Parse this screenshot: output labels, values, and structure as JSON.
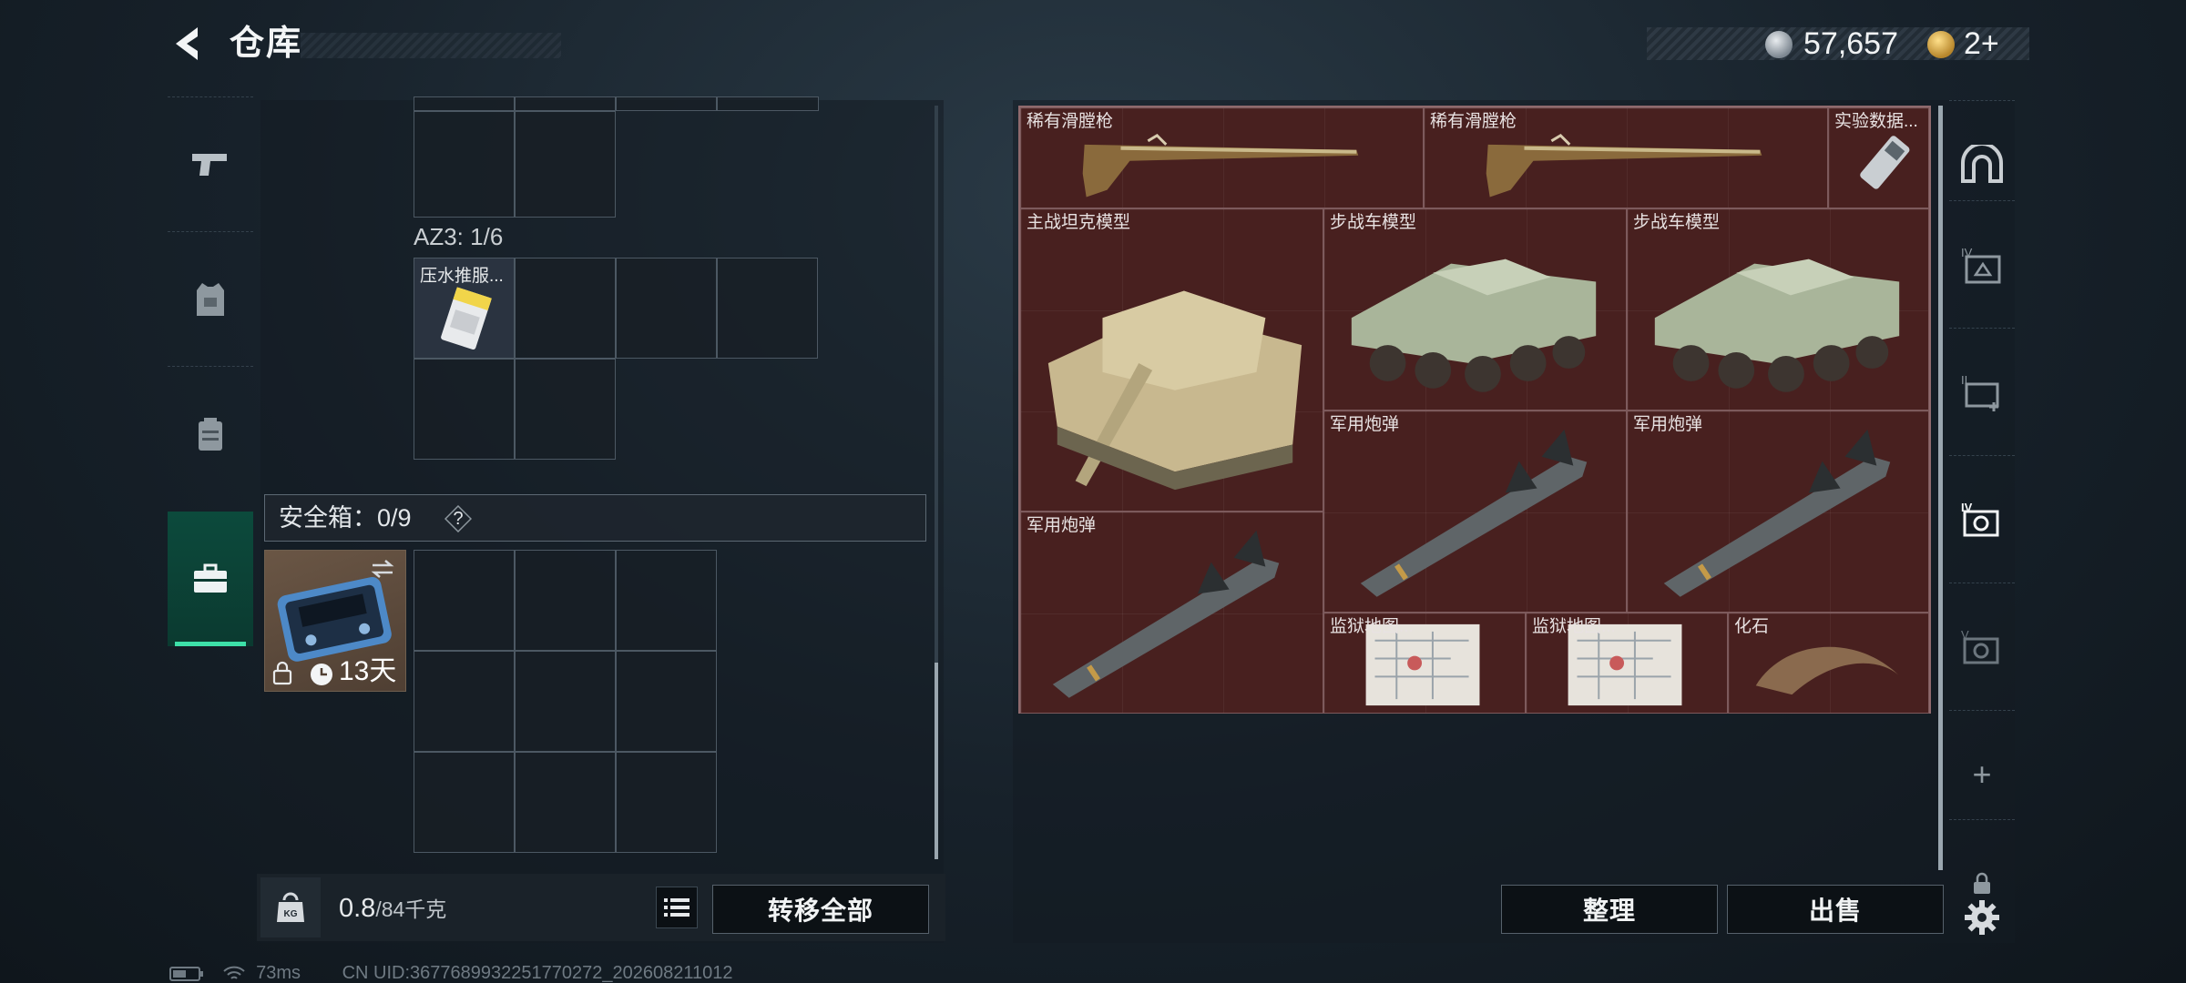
{
  "header": {
    "title": "仓库"
  },
  "currency": {
    "coins": "57,657",
    "tickets": "2+"
  },
  "left_panel": {
    "az3_label": "AZ3: 1/6",
    "az3_item_name": "压水推服...",
    "safebox_label": "安全箱：0/9",
    "safebox_help": "?",
    "safebox_timer": "13天",
    "weight_value": "0.8",
    "weight_capacity": "/84千克",
    "transfer_all": "转移全部"
  },
  "stash": {
    "items": [
      {
        "name": "稀有滑膛枪"
      },
      {
        "name": "稀有滑膛枪"
      },
      {
        "name": "实验数据..."
      },
      {
        "name": "主战坦克模型"
      },
      {
        "name": "步战车模型"
      },
      {
        "name": "步战车模型"
      },
      {
        "name": "军用炮弹"
      },
      {
        "name": "军用炮弹"
      },
      {
        "name": "军用炮弹"
      },
      {
        "name": "监狱地图..."
      },
      {
        "name": "监狱地图..."
      },
      {
        "name": "化石"
      }
    ],
    "sort_button": "整理",
    "sell_button": "出售"
  },
  "right_tabs": {
    "plus": "+"
  },
  "status": {
    "ping": "73ms",
    "uid": "CN UID:3677689932251770272_202608211012"
  },
  "colors": {
    "accent": "#3de0a8",
    "stash_bg": "#4b1f23"
  }
}
